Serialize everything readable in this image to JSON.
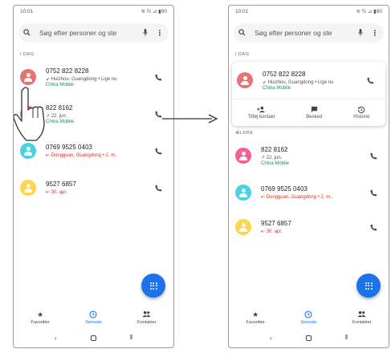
{
  "status": {
    "time": "10:01",
    "right": "≋ ℕ ⊿ ▮90"
  },
  "search": {
    "placeholder": "Søg efter personer og ste"
  },
  "sections": {
    "today": "I DAG",
    "previous": "ÆLDRE"
  },
  "calls": [
    {
      "number": "0752 822 8228",
      "detail": "↙ Huizhou, Guangdong • Lige nu",
      "carrier": "China Mobile",
      "avatar_color": "#e57373",
      "missed": false
    },
    {
      "number": "822 8162",
      "detail": "↗ 22. jun.",
      "carrier": "China Mobile",
      "avatar_color": "#f06292",
      "missed": false
    },
    {
      "number": "0769 9525 0403",
      "detail": "↜ Dongguan, Guangdong • 2. m..",
      "carrier": "",
      "avatar_color": "#4dd0e1",
      "missed": true
    },
    {
      "number": "9527 6857",
      "detail": "↜ 30. apr.",
      "carrier": "",
      "avatar_color": "#ffd54f",
      "missed": true
    }
  ],
  "actions": {
    "add_contact": "Tilføj kontakt",
    "message": "Besked",
    "history": "Historie"
  },
  "nav": {
    "favorites": "Favoritter",
    "recents": "Seneste",
    "contacts": "Kontakter"
  },
  "icons": {
    "search": "search-icon",
    "mic": "mic-icon",
    "more": "more-vert-icon",
    "phone": "phone-icon",
    "dialpad": "dialpad-icon",
    "star": "star-icon",
    "clock": "clock-icon",
    "people": "people-icon",
    "add_person": "add-person-icon",
    "message": "message-icon",
    "history": "history-icon"
  },
  "colors": {
    "accent": "#1a73e8",
    "missed": "#d93025",
    "carrier": "#1a8a55"
  }
}
